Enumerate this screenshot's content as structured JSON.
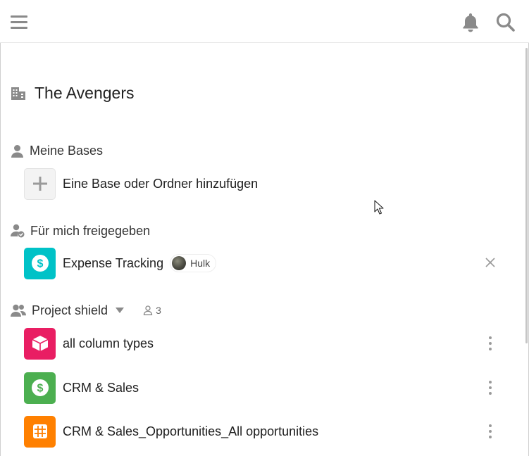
{
  "header": {
    "menu_icon": "hamburger-icon",
    "notifications_icon": "bell-icon",
    "search_icon": "search-icon"
  },
  "team": {
    "title": "The Avengers",
    "icon": "building-icon"
  },
  "sections": {
    "my_bases": {
      "label": "Meine Bases",
      "icon": "user-icon",
      "add_label": "Eine Base oder Ordner hinzufügen"
    },
    "shared": {
      "label": "Für mich freigegeben",
      "icon": "user-shared-icon",
      "items": [
        {
          "name": "Expense Tracking",
          "owner": "Hulk",
          "color": "#00c2c7",
          "icon": "dollar-icon"
        }
      ]
    },
    "group": {
      "label": "Project shield",
      "icon": "group-icon",
      "member_count": "3",
      "items": [
        {
          "name": "all column types",
          "color": "#e91e63",
          "icon": "box-icon"
        },
        {
          "name": "CRM & Sales",
          "color": "#4caf50",
          "icon": "dollar-icon"
        },
        {
          "name": "CRM & Sales_Opportunities_All opportunities",
          "color": "#ff8000",
          "icon": "grid-icon"
        }
      ]
    }
  },
  "colors": {
    "icon_gray": "#8a8a8a",
    "text": "#212121"
  }
}
